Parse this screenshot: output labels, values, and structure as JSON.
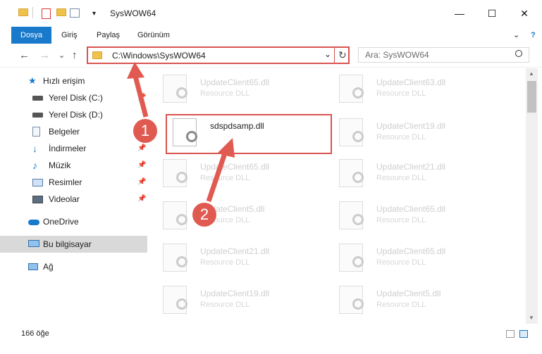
{
  "window": {
    "title": "SysWOW64",
    "minimize_symbol": "—",
    "maximize_symbol": "☐",
    "close_symbol": "✕"
  },
  "ribbon": {
    "tabs": [
      {
        "label": "Dosya",
        "active": true
      },
      {
        "label": "Giriş"
      },
      {
        "label": "Paylaş"
      },
      {
        "label": "Görünüm"
      }
    ],
    "collapse_symbol": "⌄",
    "help_symbol": "?"
  },
  "nav": {
    "back": "←",
    "forward": "→",
    "recent": "⌄",
    "up": "↑",
    "refresh": "↻",
    "dropdown": "⌄"
  },
  "address": {
    "path": "C:\\Windows\\SysWOW64"
  },
  "search": {
    "placeholder": "Ara: SysWOW64",
    "icon": "search-icon"
  },
  "sidebar": {
    "items": [
      {
        "label": "Hızlı erişim",
        "icon": "quick-access-star-icon"
      },
      {
        "label": "Yerel Disk (C:)",
        "icon": "drive-icon",
        "pin": "📌"
      },
      {
        "label": "Yerel Disk (D:)",
        "icon": "drive-icon"
      },
      {
        "label": "Belgeler",
        "icon": "documents-icon",
        "pin": "📌"
      },
      {
        "label": "İndirmeler",
        "icon": "downloads-icon",
        "pin": "📌"
      },
      {
        "label": "Müzik",
        "icon": "music-icon",
        "pin": "📌"
      },
      {
        "label": "Resimler",
        "icon": "pictures-icon",
        "pin": "📌"
      },
      {
        "label": "Videolar",
        "icon": "videos-icon",
        "pin": "📌"
      },
      {
        "label": "OneDrive",
        "icon": "onedrive-icon"
      },
      {
        "label": "Bu bilgisayar",
        "icon": "computer-icon"
      },
      {
        "label": "Ağ",
        "icon": "network-icon"
      }
    ]
  },
  "files": [
    {
      "name": "UpdateClient65.dll",
      "type": "Resource DLL"
    },
    {
      "name": "UpdateClient63.dll",
      "type": "Resource DLL"
    },
    {
      "name": "sdspdsamp.dll",
      "type": ""
    },
    {
      "name": "UpdateClient19.dll",
      "type": "Resource DLL"
    },
    {
      "name": "UpdateClient65.dll",
      "type": "Resource DLL"
    },
    {
      "name": "UpdateClient21.dll",
      "type": "Resource DLL"
    },
    {
      "name": "UpdateClient5.dll",
      "type": "Resource DLL"
    },
    {
      "name": "UpdateClient65.dll",
      "type": "Resource DLL"
    },
    {
      "name": "UpdateClient21.dll",
      "type": "Resource DLL"
    },
    {
      "name": "UpdateClient65.dll",
      "type": "Resource DLL"
    },
    {
      "name": "UpdateClient19.dll",
      "type": "Resource DLL"
    },
    {
      "name": "UpdateClient5.dll",
      "type": "Resource DLL"
    }
  ],
  "status": {
    "item_count": "166 öğe"
  },
  "annotations": {
    "badge1": "1",
    "badge2": "2"
  },
  "colors": {
    "accent": "#1979ca",
    "annotation": "#e05a52"
  }
}
